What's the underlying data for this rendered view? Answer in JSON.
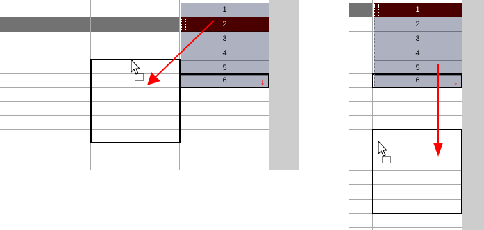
{
  "left": {
    "rows": [
      "1",
      "2",
      "3",
      "4",
      "5",
      "6"
    ],
    "selected_row": "2",
    "drop_marker": "↓"
  },
  "right": {
    "rows": [
      "1",
      "2",
      "3",
      "4",
      "5",
      "6"
    ],
    "selected_row": "1",
    "drop_marker": "↓"
  },
  "colors": {
    "cell": "#aeb1c0",
    "selected_cell": "#4b0000",
    "arrow": "#ff0000",
    "selected_row": "#727272"
  },
  "icons": [
    "cursor-arrow-icon",
    "drag-copy-icon",
    "drop-marker-icon"
  ]
}
